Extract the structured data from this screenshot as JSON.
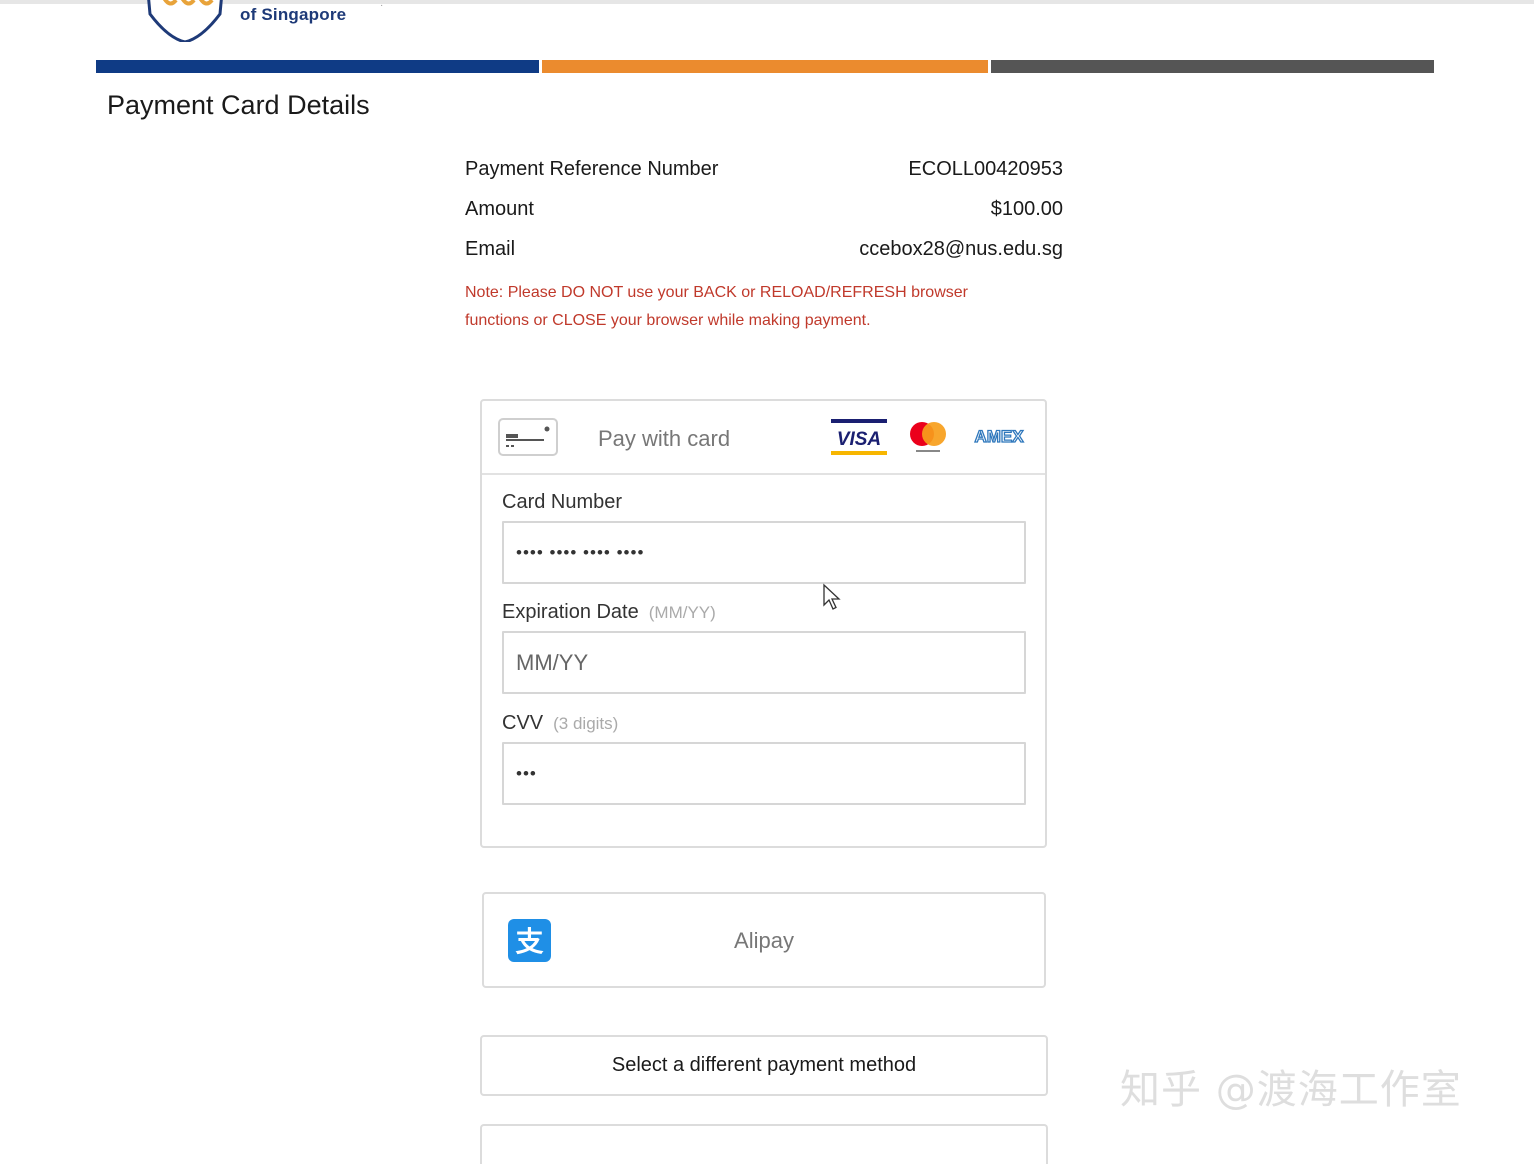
{
  "header": {
    "logo_text": "of Singapore",
    "brand_colors": {
      "blue": "#0f3b85",
      "orange": "#eb8b2e",
      "gray": "#555555"
    }
  },
  "page_title": "Payment Card Details",
  "summary": {
    "reference": {
      "label": "Payment Reference Number",
      "value": "ECOLL00420953"
    },
    "amount": {
      "label": "Amount",
      "value": "$100.00"
    },
    "email": {
      "label": "Email",
      "value": "ccebox28@nus.edu.sg"
    }
  },
  "note": "Note: Please DO NOT use your BACK or RELOAD/REFRESH browser functions or CLOSE your browser while making payment.",
  "card_form": {
    "header_label": "Pay with card",
    "header_icon": "credit-card-icon",
    "brands": [
      "visa-logo",
      "mastercard-logo",
      "amex-logo"
    ],
    "visa_text": "VISA",
    "amex_text": "AMEX",
    "card_number": {
      "label": "Card Number",
      "value": "•••• •••• •••• ••••"
    },
    "expiration": {
      "label": "Expiration Date",
      "hint": "(MM/YY)",
      "placeholder": "MM/YY",
      "value": ""
    },
    "cvv": {
      "label": "CVV",
      "hint": "(3 digits)",
      "value": "•••"
    }
  },
  "alipay": {
    "label": "Alipay",
    "icon": "alipay-icon",
    "icon_char": "支"
  },
  "select_method": {
    "label": "Select a different payment method"
  },
  "watermark": "知乎 @渡海工作室"
}
